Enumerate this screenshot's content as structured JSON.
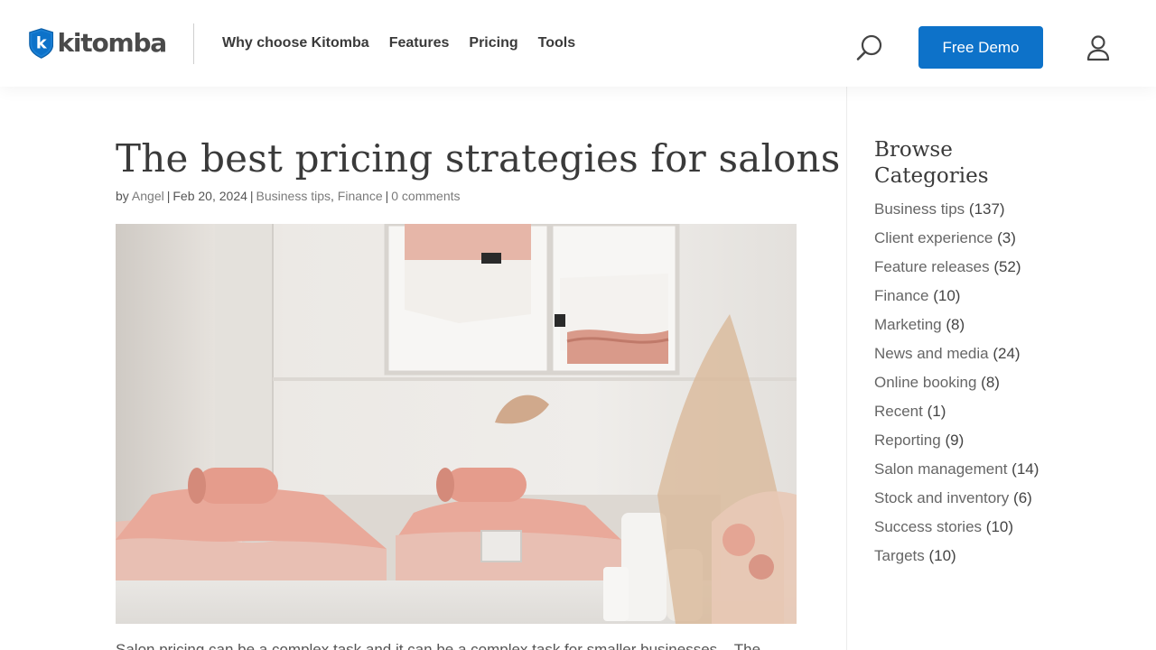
{
  "header": {
    "logo_text": "kitomba",
    "nav": [
      {
        "label": "Why choose Kitomba"
      },
      {
        "label": "Features"
      },
      {
        "label": "Pricing"
      },
      {
        "label": "Tools"
      }
    ],
    "demo_label": "Free Demo",
    "icons": {
      "search": "search-icon",
      "user": "user-icon"
    }
  },
  "post": {
    "title": "The best pricing strategies for salons",
    "by": "by",
    "author": "Angel",
    "date": "Feb 20, 2024",
    "category_1": "Business tips",
    "category_2": "Finance",
    "comments": "0 comments",
    "excerpt": "Salon pricing can be a complex task and it can be a complex task for smaller businesses... The"
  },
  "sidebar": {
    "title": "Browse Categories",
    "categories": [
      {
        "name": "Business tips",
        "count": "(137)"
      },
      {
        "name": "Client experience",
        "count": "(3)"
      },
      {
        "name": "Feature releases",
        "count": "(52)"
      },
      {
        "name": "Finance",
        "count": "(10)"
      },
      {
        "name": "Marketing",
        "count": "(8)"
      },
      {
        "name": "News and media",
        "count": "(24)"
      },
      {
        "name": "Online booking",
        "count": "(8)"
      },
      {
        "name": "Recent",
        "count": "(1)"
      },
      {
        "name": "Reporting",
        "count": "(9)"
      },
      {
        "name": "Salon management",
        "count": "(14)"
      },
      {
        "name": "Stock and inventory",
        "count": "(6)"
      },
      {
        "name": "Success stories",
        "count": "(10)"
      },
      {
        "name": "Targets",
        "count": "(10)"
      }
    ]
  },
  "colors": {
    "brand_blue": "#0d72c9",
    "text_dark": "#3a3a3a",
    "link_grey": "#666666"
  }
}
